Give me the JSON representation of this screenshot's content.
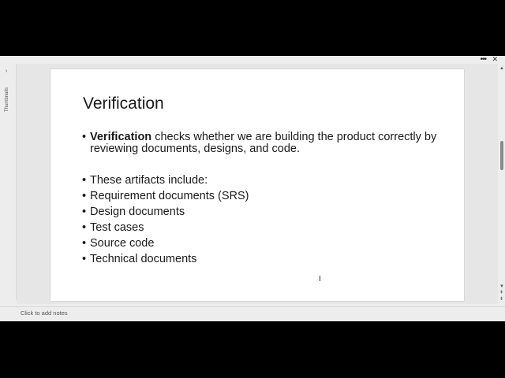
{
  "window": {
    "more_icon": "more-options-icon",
    "more_glyph": "•••",
    "close_icon": "close-icon",
    "close_glyph": "✕"
  },
  "thumbnails_pane": {
    "label": "Thumbnails",
    "toggle_glyph": "›"
  },
  "slide": {
    "title": "Verification",
    "bullet_glyph": "•",
    "intro": {
      "bold_term": "Verification",
      "text": " checks whether we are building the product correctly by reviewing documents, designs, and code."
    },
    "items": [
      "These artifacts include:",
      "Requirement documents (SRS)",
      "Design documents",
      "Test cases",
      "Source code",
      "Technical documents"
    ]
  },
  "cursor": {
    "icon": "text-cursor-icon",
    "glyph": "I"
  },
  "scrollbar": {
    "up_glyph": "▲",
    "down_glyph": "▼",
    "prev_glyph": "⇞",
    "next_glyph": "⇟"
  },
  "notes": {
    "placeholder": "Click to add notes"
  }
}
